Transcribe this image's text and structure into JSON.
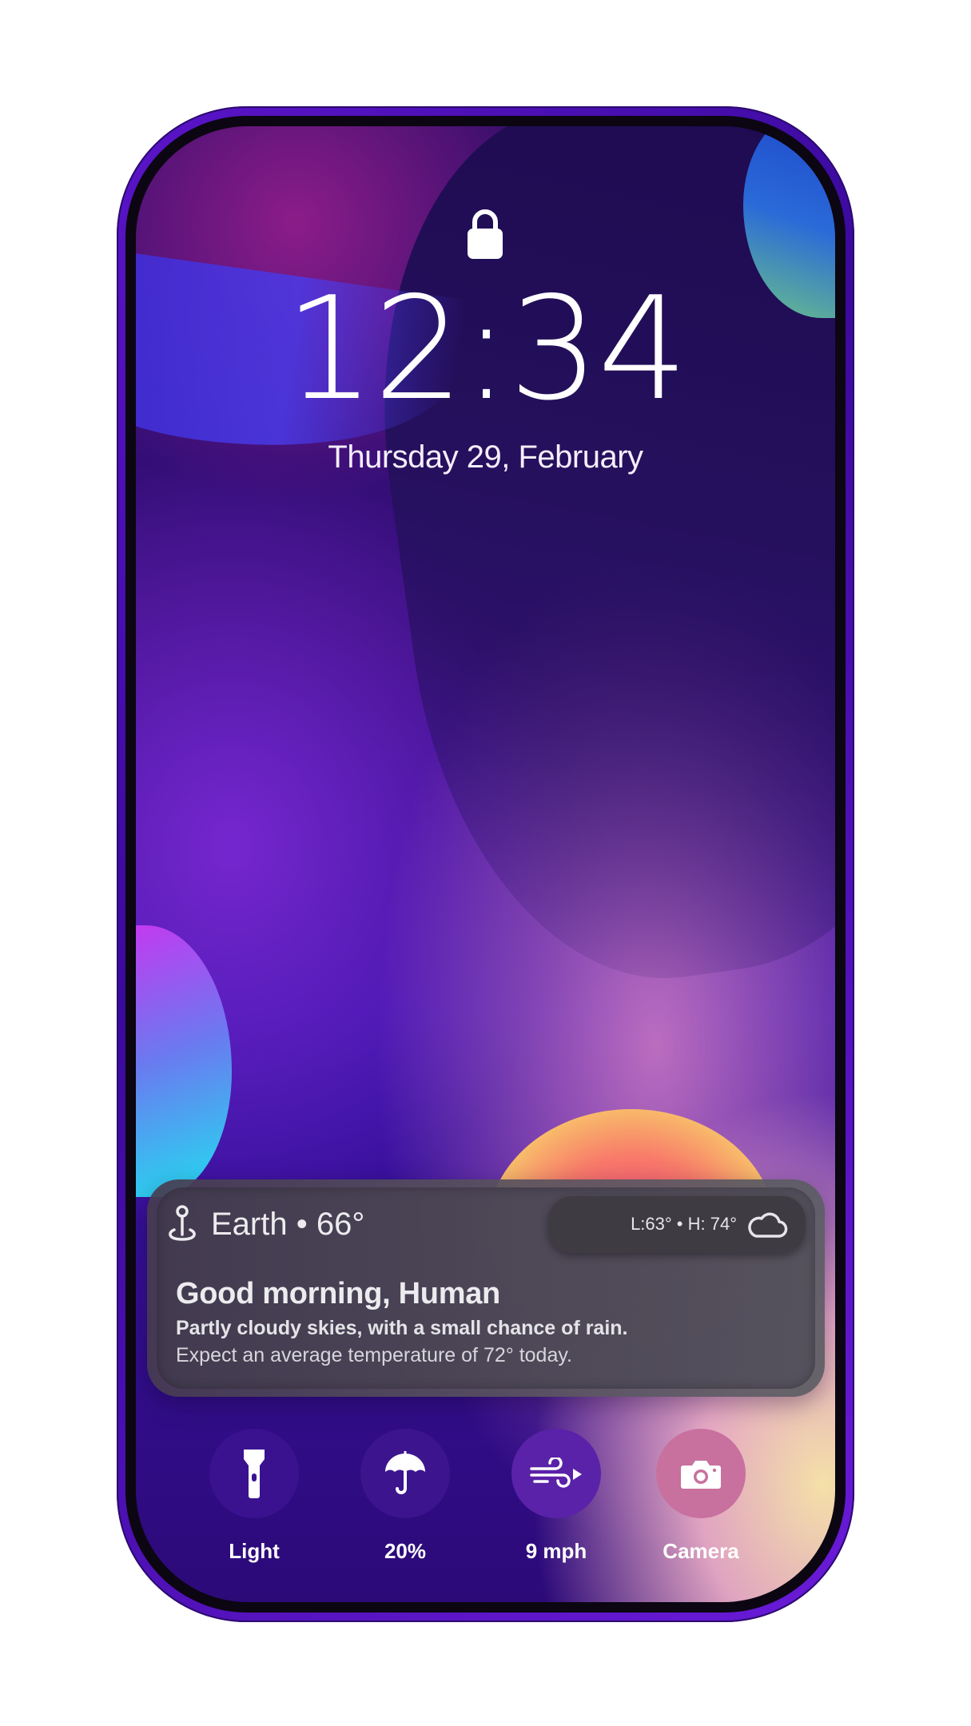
{
  "lockscreen": {
    "time": "12:34",
    "date": "Thursday 29, February"
  },
  "weather_widget": {
    "location_temp": "Earth • 66°",
    "range": "L:63° • H: 74°",
    "greeting": "Good morning, Human",
    "forecast": "Partly cloudy skies, with a small chance of rain.",
    "expectation": "Expect an average temperature of 72° today."
  },
  "quick_actions": [
    {
      "label": "Light",
      "icon": "flashlight-icon"
    },
    {
      "label": "20%",
      "icon": "umbrella-icon"
    },
    {
      "label": "9 mph",
      "icon": "wind-icon"
    },
    {
      "label": "Camera",
      "icon": "camera-icon"
    }
  ],
  "colors": {
    "frame": "#4a10b8",
    "widget_bg": "#5a5462",
    "text": "#ffffff"
  }
}
